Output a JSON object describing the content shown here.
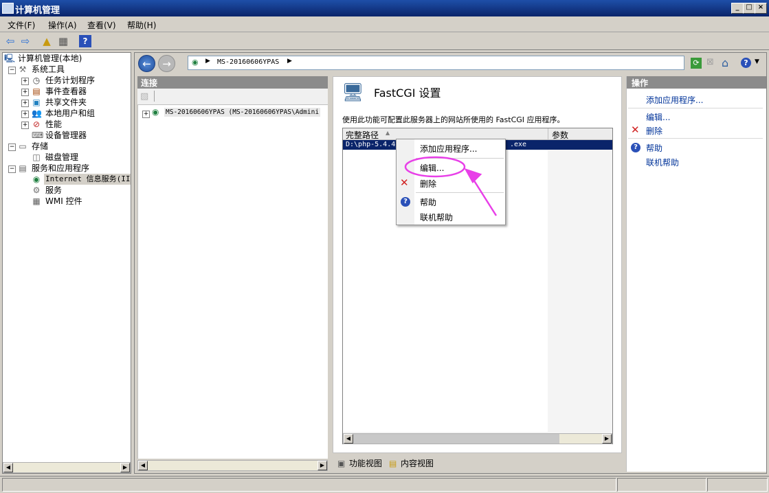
{
  "window": {
    "title": "计算机管理",
    "controls": [
      "_",
      "□",
      "×"
    ]
  },
  "menu": [
    "文件(F)",
    "操作(A)",
    "查看(V)",
    "帮助(H)"
  ],
  "tree": {
    "root": "计算机管理(本地)",
    "system_tools": "系统工具",
    "task_scheduler": "任务计划程序",
    "event_viewer": "事件查看器",
    "shared_folders": "共享文件夹",
    "local_users": "本地用户和组",
    "performance": "性能",
    "device_manager": "设备管理器",
    "storage": "存储",
    "disk_mgmt": "磁盘管理",
    "services_apps": "服务和应用程序",
    "iis": "Internet 信息服务(IIS",
    "services": "服务",
    "wmi": "WMI 控件"
  },
  "address": {
    "crumb": "MS-20160606YPAS"
  },
  "connections": {
    "header": "连接",
    "node": "MS-20160606YPAS (MS-20160606YPAS\\Admini"
  },
  "fastcgi": {
    "title": "FastCGI 设置",
    "description": "使用此功能可配置此服务器上的网站所使用的 FastCGI 应用程序。",
    "col_path": "完整路径",
    "col_args": "参数",
    "row_path_start": "D:\\php-5.4.4",
    "row_path_end": ".exe"
  },
  "context_menu": {
    "add": "添加应用程序...",
    "edit": "编辑...",
    "delete": "删除",
    "help": "帮助",
    "online_help": "联机帮助"
  },
  "actions": {
    "header": "操作",
    "add": "添加应用程序...",
    "edit": "编辑...",
    "delete": "删除",
    "help": "帮助",
    "online_help": "联机帮助"
  },
  "views": {
    "features": "功能视图",
    "content": "内容视图"
  },
  "colors": {
    "annotation": "#e83fe8",
    "selection": "#0a246a",
    "link": "#003399"
  }
}
